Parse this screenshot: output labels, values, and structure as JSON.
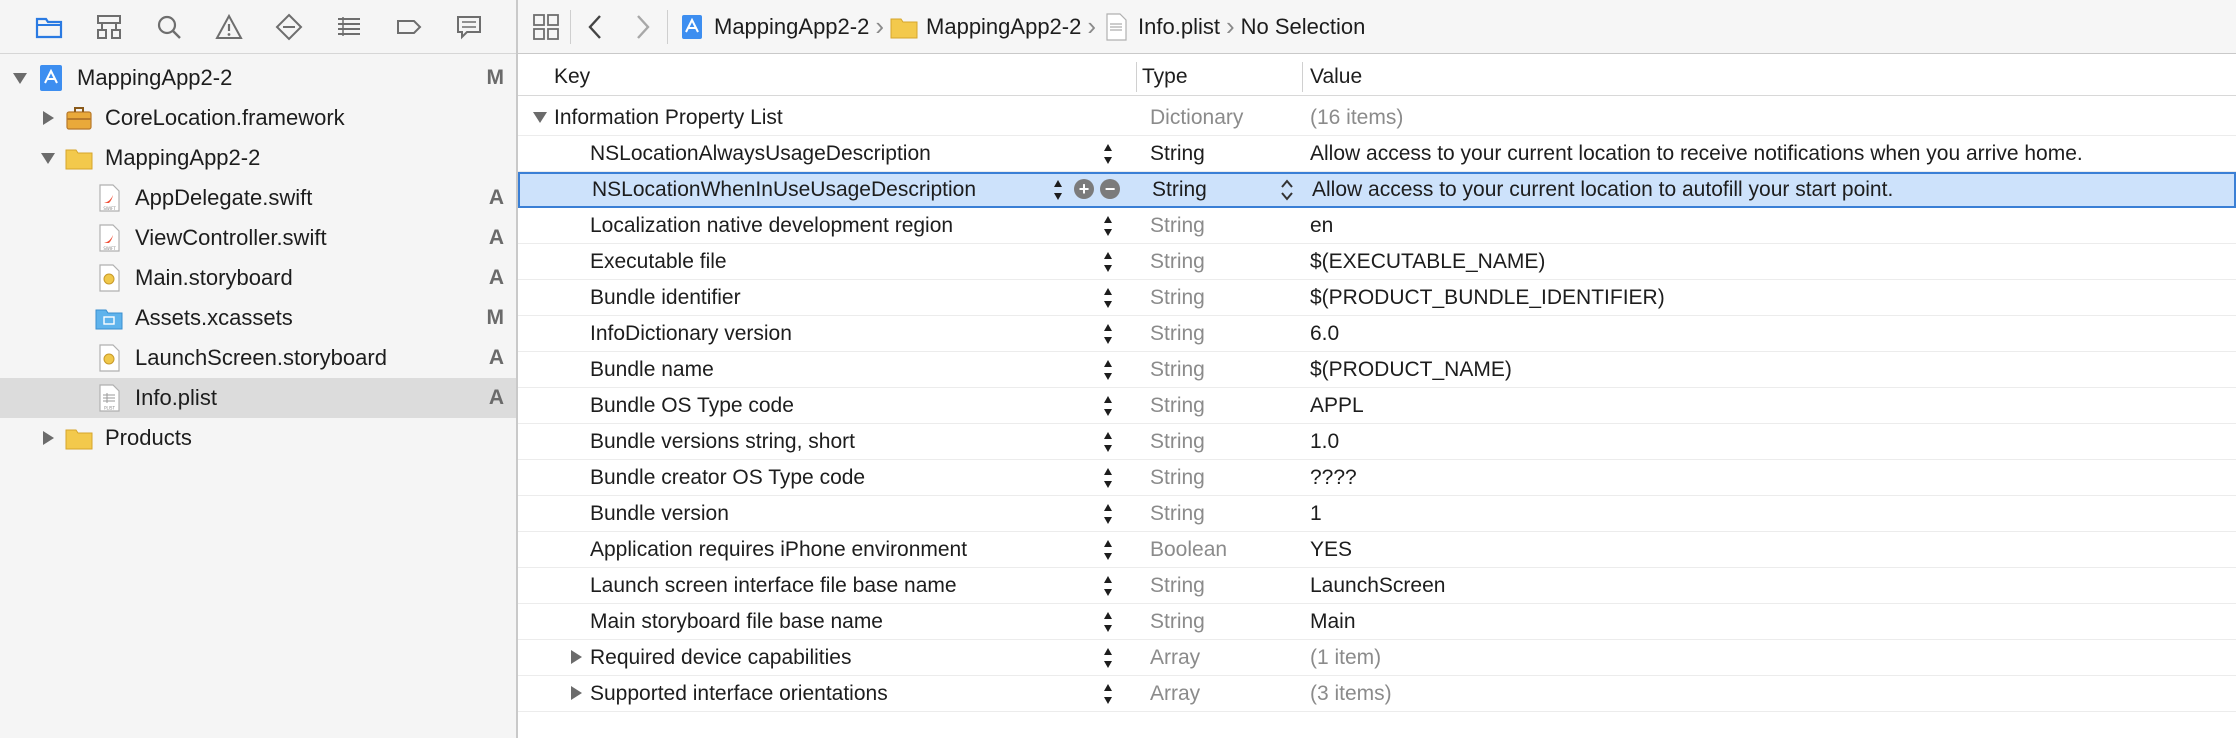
{
  "navigator": {
    "toolbar_icons": [
      "folder-icon",
      "hierarchy-icon",
      "search-icon",
      "warning-icon",
      "breakpoint-icon",
      "list-icon",
      "tag-icon",
      "comment-icon"
    ],
    "items": [
      {
        "label": "MappingApp2-2",
        "status": "M",
        "icon": "xcode-project-icon",
        "level": 0,
        "disclosure": "open"
      },
      {
        "label": "CoreLocation.framework",
        "status": "",
        "icon": "toolbox-icon",
        "level": 1,
        "disclosure": "closed"
      },
      {
        "label": "MappingApp2-2",
        "status": "",
        "icon": "folder-icon",
        "level": 1,
        "disclosure": "open"
      },
      {
        "label": "AppDelegate.swift",
        "status": "A",
        "icon": "swift-file-icon",
        "level": 2,
        "disclosure": ""
      },
      {
        "label": "ViewController.swift",
        "status": "A",
        "icon": "swift-file-icon",
        "level": 2,
        "disclosure": ""
      },
      {
        "label": "Main.storyboard",
        "status": "A",
        "icon": "storyboard-file-icon",
        "level": 2,
        "disclosure": ""
      },
      {
        "label": "Assets.xcassets",
        "status": "M",
        "icon": "assets-folder-icon",
        "level": 2,
        "disclosure": ""
      },
      {
        "label": "LaunchScreen.storyboard",
        "status": "A",
        "icon": "storyboard-file-icon",
        "level": 2,
        "disclosure": ""
      },
      {
        "label": "Info.plist",
        "status": "A",
        "icon": "plist-file-icon",
        "level": 2,
        "disclosure": "",
        "selected": true
      },
      {
        "label": "Products",
        "status": "",
        "icon": "folder-icon",
        "level": 1,
        "disclosure": "closed"
      }
    ]
  },
  "jumpbar": {
    "crumbs": [
      "MappingApp2-2",
      "MappingApp2-2",
      "Info.plist",
      "No Selection"
    ]
  },
  "plist": {
    "headers": {
      "key": "Key",
      "type": "Type",
      "value": "Value"
    },
    "rows": [
      {
        "key": "Information Property List",
        "type": "Dictionary",
        "value": "(16 items)",
        "root": true
      },
      {
        "key": "NSLocationAlwaysUsageDescription",
        "type": "String",
        "value": "Allow access to your current location to receive notifications when you arrive home.",
        "strong": true
      },
      {
        "key": "NSLocationWhenInUseUsageDescription",
        "type": "String",
        "value": "Allow access to your current location to autofill your start point.",
        "strong": true,
        "selected": true
      },
      {
        "key": "Localization native development region",
        "type": "String",
        "value": "en"
      },
      {
        "key": "Executable file",
        "type": "String",
        "value": "$(EXECUTABLE_NAME)"
      },
      {
        "key": "Bundle identifier",
        "type": "String",
        "value": "$(PRODUCT_BUNDLE_IDENTIFIER)"
      },
      {
        "key": "InfoDictionary version",
        "type": "String",
        "value": "6.0"
      },
      {
        "key": "Bundle name",
        "type": "String",
        "value": "$(PRODUCT_NAME)"
      },
      {
        "key": "Bundle OS Type code",
        "type": "String",
        "value": "APPL"
      },
      {
        "key": "Bundle versions string, short",
        "type": "String",
        "value": "1.0"
      },
      {
        "key": "Bundle creator OS Type code",
        "type": "String",
        "value": "????"
      },
      {
        "key": "Bundle version",
        "type": "String",
        "value": "1"
      },
      {
        "key": "Application requires iPhone environment",
        "type": "Boolean",
        "value": "YES"
      },
      {
        "key": "Launch screen interface file base name",
        "type": "String",
        "value": "LaunchScreen"
      },
      {
        "key": "Main storyboard file base name",
        "type": "String",
        "value": "Main"
      },
      {
        "key": "Required device capabilities",
        "type": "Array",
        "value": "(1 item)",
        "collapsed": true
      },
      {
        "key": "Supported interface orientations",
        "type": "Array",
        "value": "(3 items)",
        "collapsed": true
      }
    ]
  }
}
